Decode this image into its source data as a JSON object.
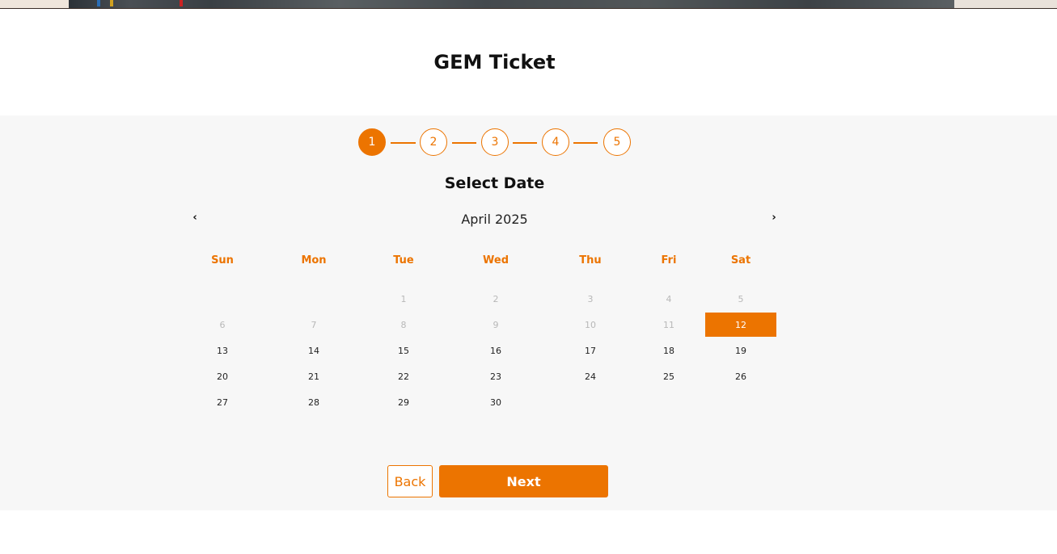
{
  "colors": {
    "accent": "#ec7400",
    "panel_bg": "#f7f7f7",
    "disabled_text": "#b8b8b8"
  },
  "header": {
    "title": "GEM Ticket"
  },
  "stepper": {
    "steps": [
      "1",
      "2",
      "3",
      "4",
      "5"
    ],
    "active_step": "1"
  },
  "calendar": {
    "heading": "Select Date",
    "month_label": "April 2025",
    "prev_icon": "chevron-left-icon",
    "next_icon": "chevron-right-icon",
    "weekdays": [
      "Sun",
      "Mon",
      "Tue",
      "Wed",
      "Thu",
      "Fri",
      "Sat"
    ],
    "weeks": [
      [
        null,
        null,
        {
          "d": "1",
          "s": "disabled"
        },
        {
          "d": "2",
          "s": "disabled"
        },
        {
          "d": "3",
          "s": "disabled"
        },
        {
          "d": "4",
          "s": "disabled"
        },
        {
          "d": "5",
          "s": "disabled"
        }
      ],
      [
        {
          "d": "6",
          "s": "disabled"
        },
        {
          "d": "7",
          "s": "disabled"
        },
        {
          "d": "8",
          "s": "disabled"
        },
        {
          "d": "9",
          "s": "disabled"
        },
        {
          "d": "10",
          "s": "disabled"
        },
        {
          "d": "11",
          "s": "disabled"
        },
        {
          "d": "12",
          "s": "selected"
        }
      ],
      [
        {
          "d": "13",
          "s": "available"
        },
        {
          "d": "14",
          "s": "available"
        },
        {
          "d": "15",
          "s": "available"
        },
        {
          "d": "16",
          "s": "available"
        },
        {
          "d": "17",
          "s": "available"
        },
        {
          "d": "18",
          "s": "available"
        },
        {
          "d": "19",
          "s": "available"
        }
      ],
      [
        {
          "d": "20",
          "s": "available"
        },
        {
          "d": "21",
          "s": "available"
        },
        {
          "d": "22",
          "s": "available"
        },
        {
          "d": "23",
          "s": "available"
        },
        {
          "d": "24",
          "s": "available"
        },
        {
          "d": "25",
          "s": "available"
        },
        {
          "d": "26",
          "s": "available"
        }
      ],
      [
        {
          "d": "27",
          "s": "available"
        },
        {
          "d": "28",
          "s": "available"
        },
        {
          "d": "29",
          "s": "available"
        },
        {
          "d": "30",
          "s": "available"
        },
        null,
        null,
        null
      ]
    ],
    "selected_date": "12"
  },
  "actions": {
    "back_label": "Back",
    "next_label": "Next"
  }
}
